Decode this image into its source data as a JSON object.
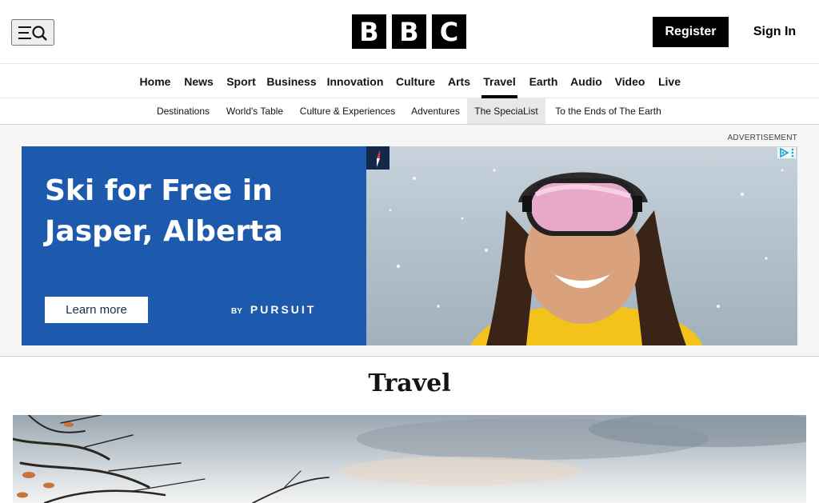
{
  "header": {
    "logo_letters": [
      "B",
      "B",
      "C"
    ],
    "register_label": "Register",
    "signin_label": "Sign In"
  },
  "primary_nav": {
    "items": [
      "Home",
      "News",
      "Sport",
      "Business",
      "Innovation",
      "Culture",
      "Arts",
      "Travel",
      "Earth",
      "Audio",
      "Video",
      "Live"
    ],
    "active": "Travel"
  },
  "secondary_nav": {
    "items": [
      "Destinations",
      "World's Table",
      "Culture & Experiences",
      "Adventures",
      "The SpeciaList",
      "To the Ends of The Earth"
    ],
    "active": "The SpeciaList"
  },
  "advertisement": {
    "label": "ADVERTISEMENT",
    "headline": "Ski for Free in Jasper, Alberta",
    "cta_label": "Learn more",
    "brand_by": "BY",
    "brand_name": "PURSUIT"
  },
  "section": {
    "title": "Travel"
  },
  "colors": {
    "ad_blue": "#1d5aad",
    "brand_black": "#000000",
    "ad_choices_cyan": "#00aecd"
  }
}
